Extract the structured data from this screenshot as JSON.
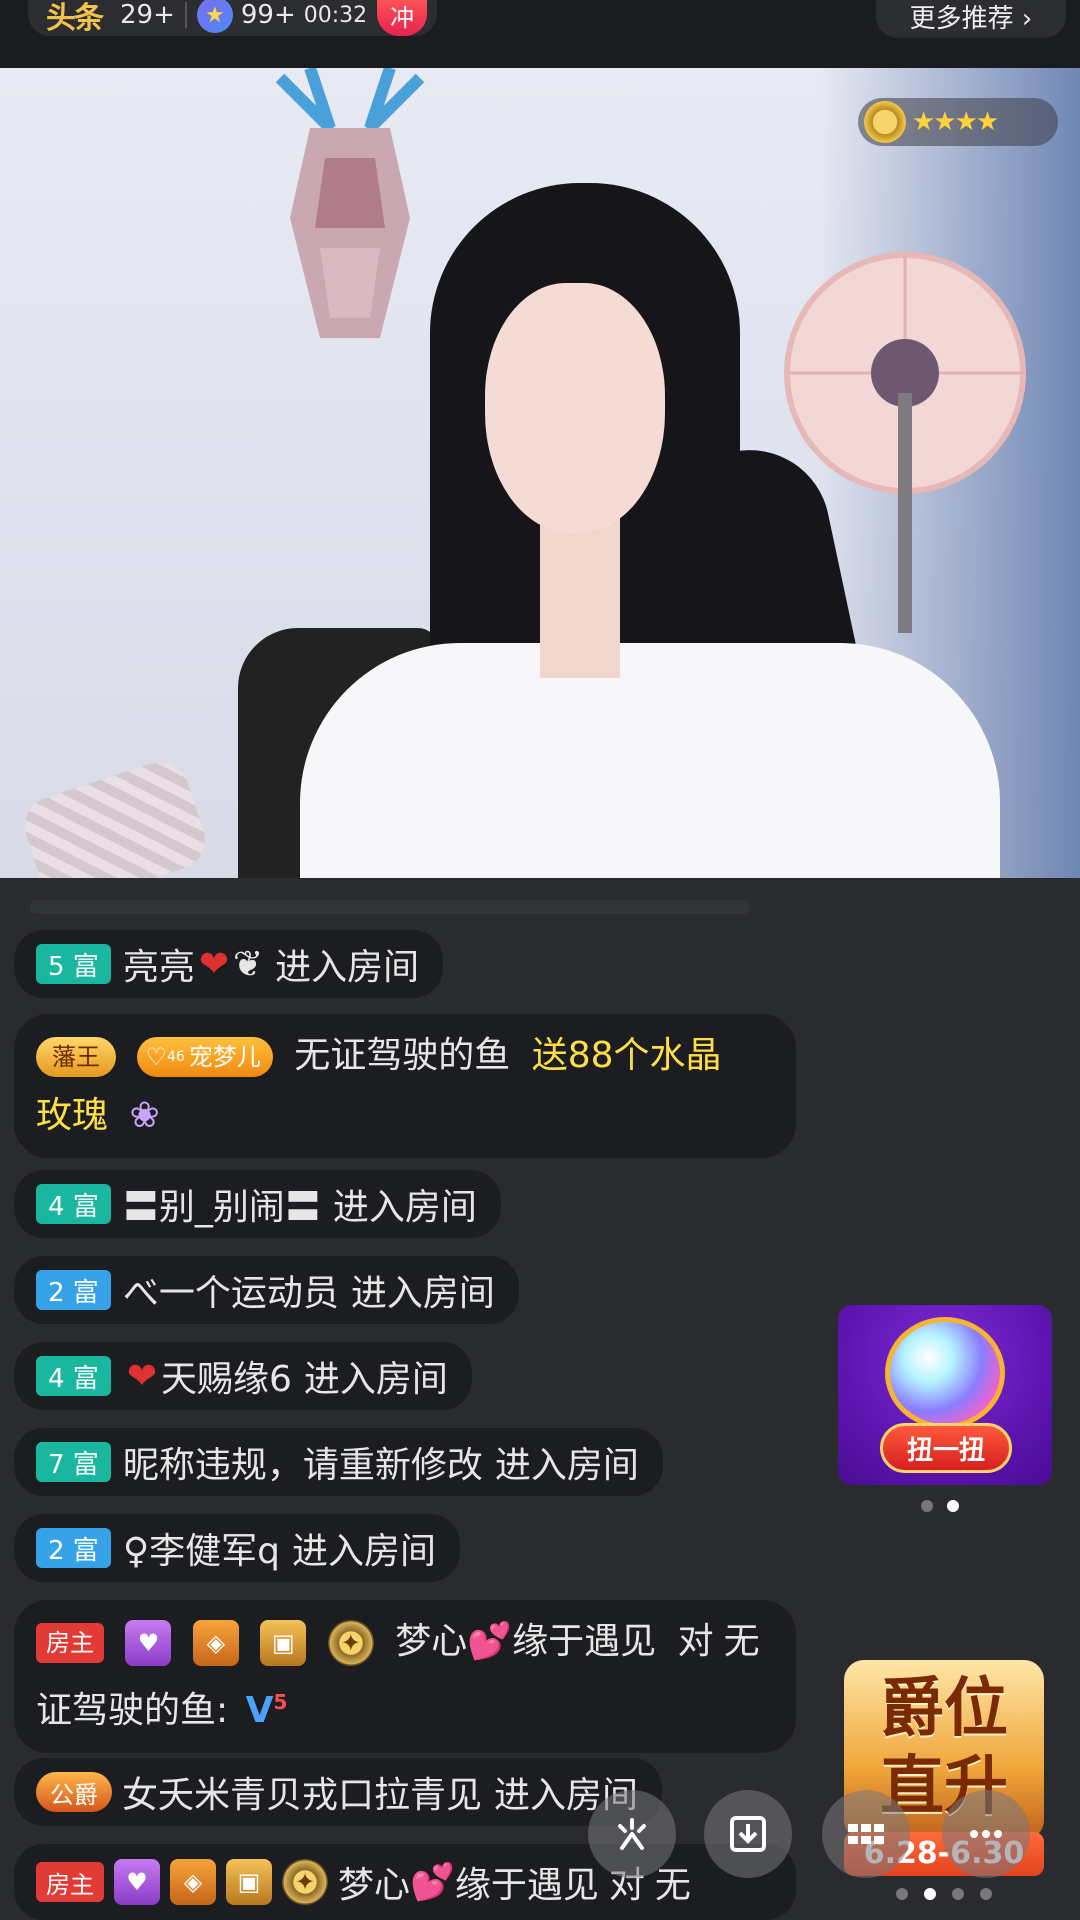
{
  "topbar": {
    "logo": "头条",
    "count1": "29+",
    "count2": "99+",
    "timer": "00:32",
    "rush": "冲",
    "more": "更多推荐 ›"
  },
  "video": {
    "watermark_stars": "★★★★"
  },
  "chat": {
    "m1": {
      "lvl": "5 富",
      "user": "亮亮",
      "deco": "❦",
      "action": "进入房间"
    },
    "m2": {
      "badge1": "藩王",
      "badge2": "宠梦儿",
      "badge2_num": "46",
      "user": "无证驾驶的鱼",
      "gift1": "送88个水晶",
      "gift2": "玫瑰"
    },
    "m3": {
      "lvl": "4 富",
      "user": "〓别_别闹〓",
      "action": "进入房间"
    },
    "m4": {
      "lvl": "2 富",
      "user": "べ一个运动员",
      "action": "进入房间"
    },
    "m5": {
      "lvl": "4 富",
      "user": "天赐缘6",
      "action": "进入房间"
    },
    "m6": {
      "lvl": "7 富",
      "user": "昵称违规，请重新修改",
      "action": "进入房间"
    },
    "m7": {
      "lvl": "2 富",
      "user": "♀李健军q",
      "action": "进入房间"
    },
    "m8": {
      "host": "房主",
      "user1": "梦心",
      "user2": "缘于遇见",
      "to": "对",
      "line1_tail": "无",
      "line2": "证驾驶的鱼:"
    },
    "m9": {
      "badge": "公爵",
      "user": "女夭米青贝戎口拉青见",
      "action": "进入房间"
    },
    "m10": {
      "host": "房主",
      "user1": "梦心",
      "user2": "缘于遇见",
      "to": "对",
      "line1_tail": "无"
    }
  },
  "widgets": {
    "gashapon_btn": "扭一扭",
    "rank_line1": "爵位",
    "rank_line2": "直升",
    "rank_date": "6.28-6.30"
  },
  "colors": {
    "bg": "#2a2b2e",
    "bubble": "#1c1d20",
    "gold_text": "#ffde48",
    "teal_level": "#19b6a0",
    "blue_level": "#36a3e9",
    "host_red": "#e23a35"
  },
  "icons": {
    "fab1": "sparkle-icon",
    "fab2": "download-icon",
    "fab3": "grid-icon",
    "fab4": "more-icon"
  }
}
